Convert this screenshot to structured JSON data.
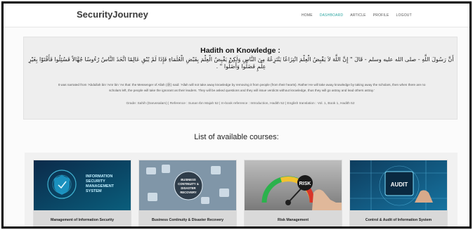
{
  "brand": "SecurityJourney",
  "nav": {
    "items": [
      "HOME",
      "DASHBOARD",
      "ARTICLE",
      "PROFILE",
      "LOGOUT"
    ],
    "active": "DASHBOARD",
    "accent_color": "#2aa5a0"
  },
  "hadith": {
    "title": "Hadith on Knowledge :",
    "arabic": "أَنَّ رَسُولَ اللَّهِ - صلى الله عليه وسلم - قَالَ ‏\"‏ إِنَّ اللَّهَ لاَ يَقْبِضُ الْعِلْمَ انْتِزَاعًا يَنْتَزِعُهُ مِنَ النَّاسِ وَلَكِنْ يَقْبِضُ الْعِلْمَ بِقَبْضِ الْعُلَمَاءِ فَإِذَا لَمْ يُبْقِ عَالِمًا اتَّخَذَ النَّاسُ رُءُوسًا جُهَّالاً فَسُئِلُوا فَأَفْتَوْا بِغَيْرِ عِلْمٍ فَضَلُّوا وَأَضَلُّوا ‏\"‏ ‏.‏",
    "english": "It was narrated from 'Abdullah bin 'Amr bin 'As that: the Messenger of Allah (ﷺ) said: 'Allah will not take away knowledge by removing it from people (from their hearts). Rather He will take away knowledge by taking away the scholars, then when there are no scholars left, the people will take the ignorant as their leaders. They will be asked questions and they will issue verdicts without knowledge, thus they will go astray and lead others astray.'",
    "grade": "Grade: Sahih (Darussalam) | Reference : Sunan Ibn Majah 52 | In-book reference : Introduction, Hadith 52 | English translation : Vol. 1, Book 1, Hadith 52"
  },
  "courses": {
    "heading": "List of available courses:",
    "items": [
      {
        "label": "Management of Information Security",
        "image_text": [
          "INFORMATION",
          "SECURITY",
          "MANAGEMENT",
          "SYSTEM"
        ]
      },
      {
        "label": "Business Continuity & Disaster Recovery",
        "image_text": [
          "BUSINESS",
          "CONTINUITY &",
          "DISASTER",
          "RECOVERY"
        ]
      },
      {
        "label": "Risk Management",
        "image_text": [
          "RISK"
        ]
      },
      {
        "label": "Control & Audit of Information System",
        "image_text": [
          "AUDIT"
        ]
      }
    ]
  }
}
